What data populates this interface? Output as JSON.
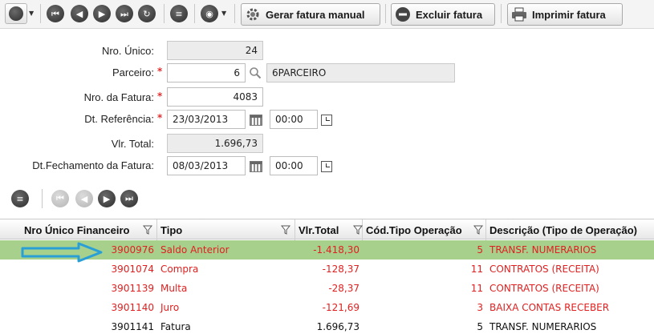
{
  "toolbar": {
    "buttons": [
      {
        "name": "grid-menu",
        "icon": "grid-icon"
      },
      {
        "name": "first-record",
        "icon": "first-icon"
      },
      {
        "name": "previous-record",
        "icon": "previous-icon"
      },
      {
        "name": "next-record",
        "icon": "next-icon"
      },
      {
        "name": "last-record",
        "icon": "last-icon"
      },
      {
        "name": "refresh",
        "icon": "refresh-icon"
      },
      {
        "name": "list-view",
        "icon": "list-icon"
      },
      {
        "name": "options-menu",
        "icon": "options-icon"
      }
    ],
    "gerar_fatura_label": "Gerar fatura manual",
    "excluir_fatura_label": "Excluir fatura",
    "imprimir_fatura_label": "Imprimir fatura"
  },
  "form": {
    "nro_unico": {
      "label": "Nro. Único:",
      "value": "24"
    },
    "parceiro": {
      "label": "Parceiro:",
      "code": "6",
      "name": "6PARCEIRO",
      "required": true
    },
    "nro_fatura": {
      "label": "Nro. da Fatura:",
      "value": "4083",
      "required": true
    },
    "dt_referencia": {
      "label": "Dt. Referência:",
      "date": "23/03/2013",
      "time": "00:00",
      "required": true
    },
    "vlr_total": {
      "label": "Vlr. Total:",
      "value": "1.696,73"
    },
    "dt_fechamento": {
      "label": "Dt.Fechamento da Fatura:",
      "date": "08/03/2013",
      "time": "00:00"
    }
  },
  "grid": {
    "columns": [
      {
        "key": "nro",
        "label": "Nro Único Financeiro"
      },
      {
        "key": "tipo",
        "label": "Tipo"
      },
      {
        "key": "vlr",
        "label": "Vlr.Total"
      },
      {
        "key": "cod",
        "label": "Cód.Tipo Operação"
      },
      {
        "key": "desc",
        "label": "Descrição (Tipo de Operação)"
      }
    ],
    "rows": [
      {
        "nro": "3900976",
        "tipo": "Saldo Anterior",
        "vlr": "-1.418,30",
        "cod": "5",
        "desc": "TRANSF. NUMERARIOS",
        "color": "#e02020",
        "selected": true
      },
      {
        "nro": "3901074",
        "tipo": "Compra",
        "vlr": "-128,37",
        "cod": "11",
        "desc": "CONTRATOS (RECEITA)",
        "color": "#e02020",
        "selected": false
      },
      {
        "nro": "3901139",
        "tipo": "Multa",
        "vlr": "-28,37",
        "cod": "11",
        "desc": "CONTRATOS (RECEITA)",
        "color": "#e02020",
        "selected": false
      },
      {
        "nro": "3901140",
        "tipo": "Juro",
        "vlr": "-121,69",
        "cod": "3",
        "desc": "BAIXA CONTAS RECEBER",
        "color": "#e02020",
        "selected": false
      },
      {
        "nro": "3901141",
        "tipo": "Fatura",
        "vlr": "1.696,73",
        "cod": "5",
        "desc": "TRANSF. NUMERARIOS",
        "color": "#111111",
        "selected": false
      }
    ]
  },
  "colors": {
    "selected_row": "#a8d08d",
    "negative_text": "#e02020",
    "required_marker": "#e03030",
    "annotation_arrow": "#2a9fd6"
  }
}
